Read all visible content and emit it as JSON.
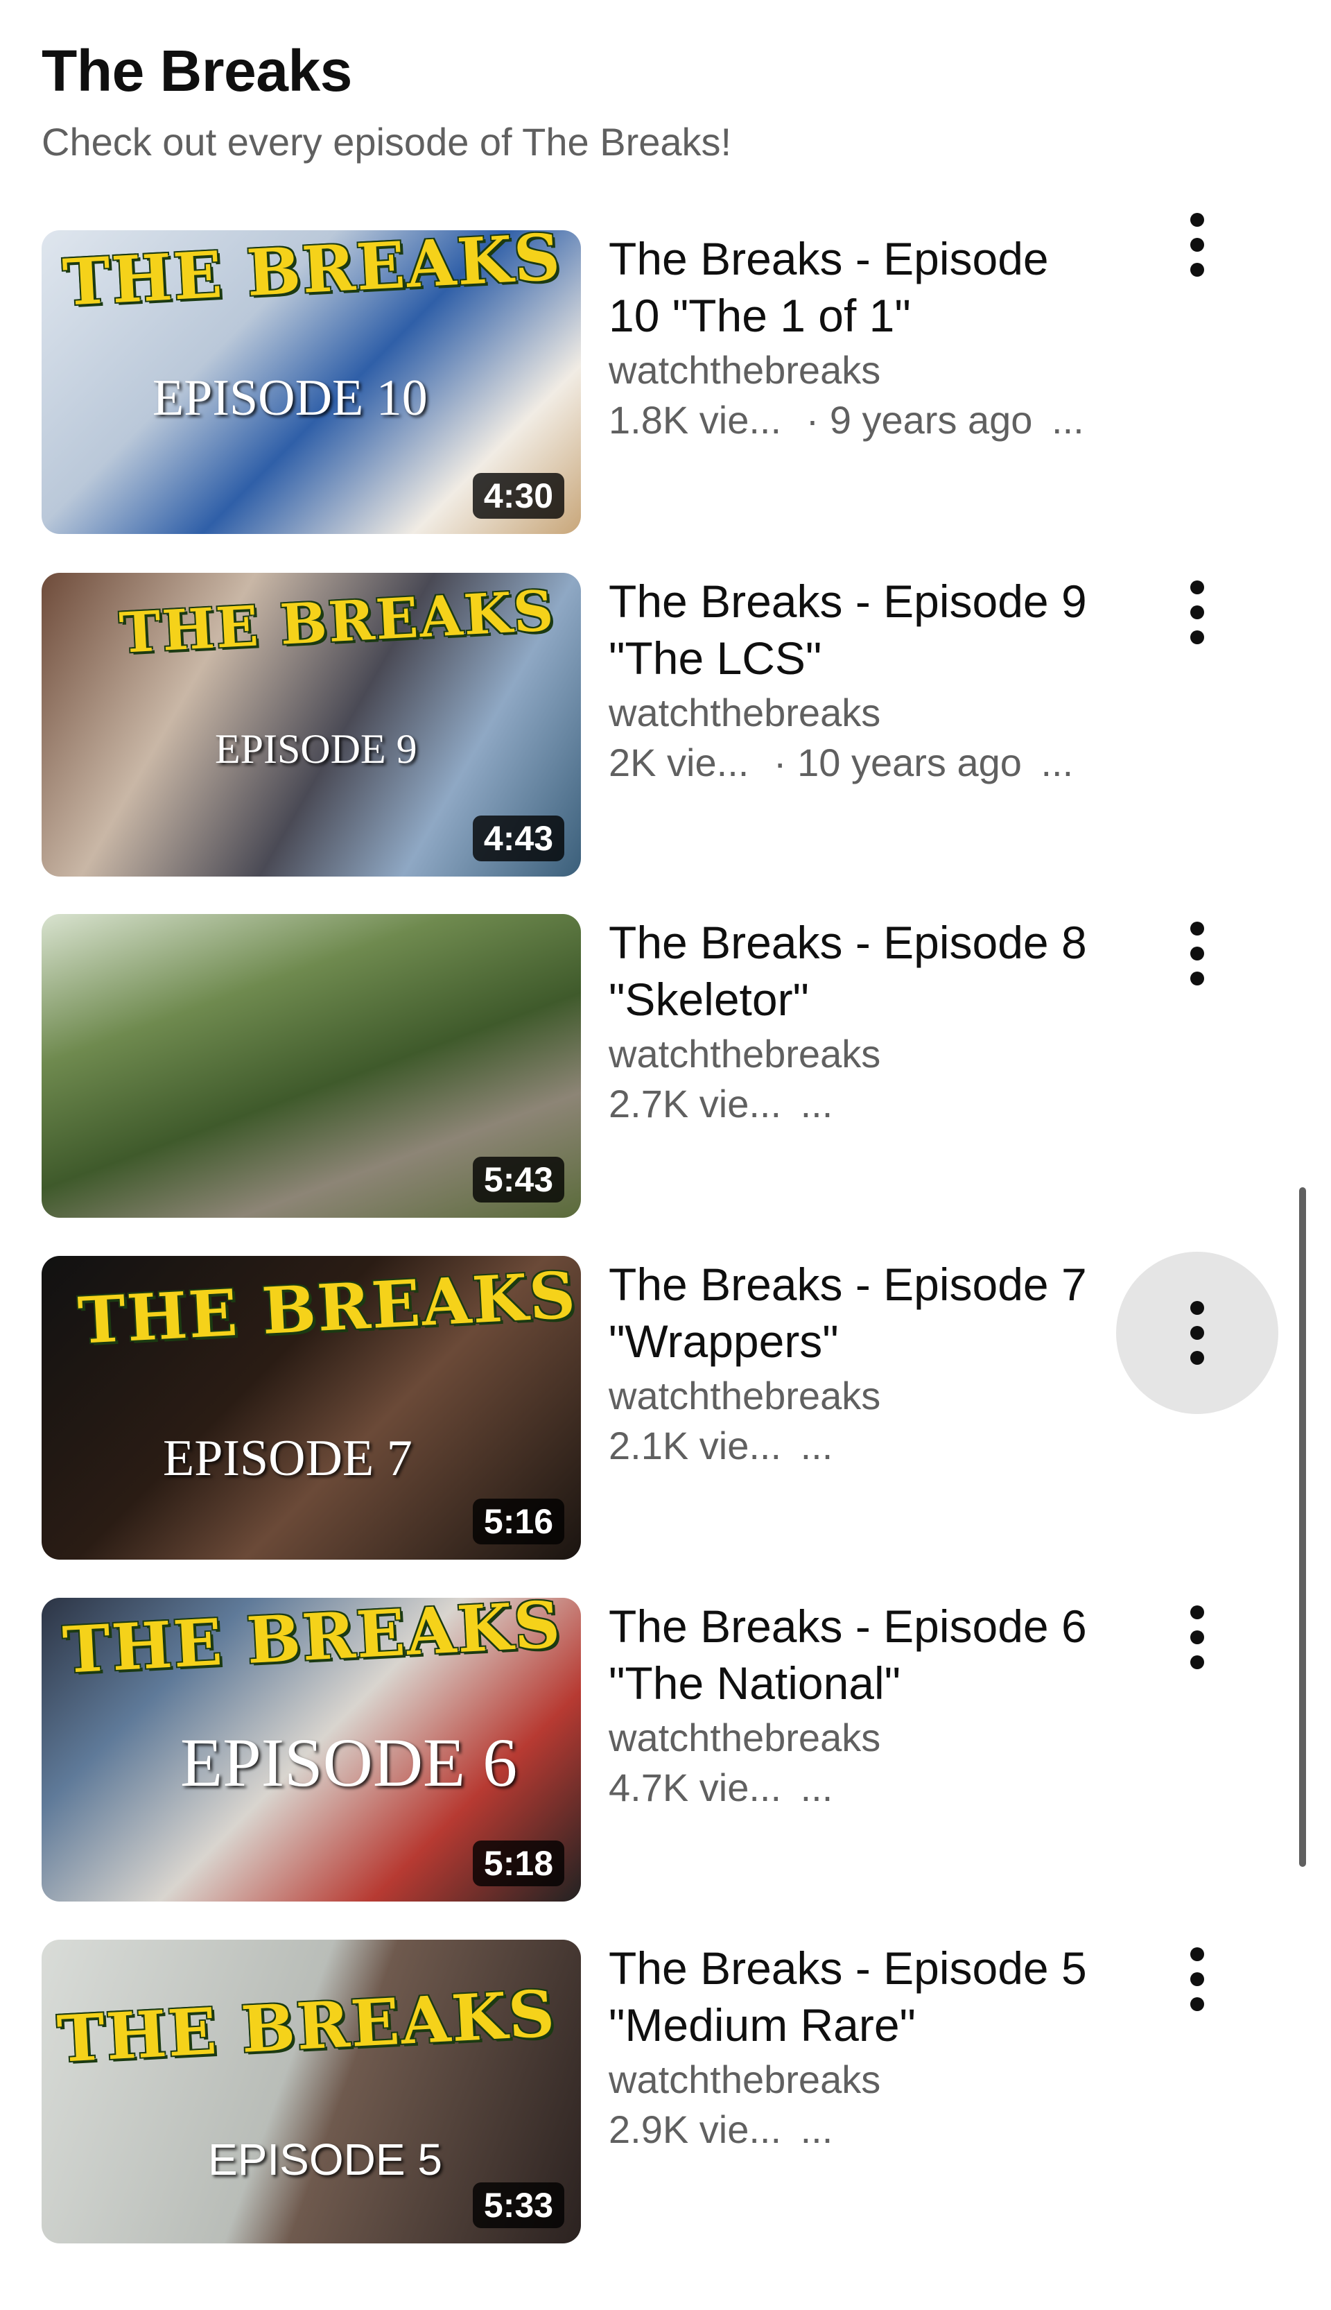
{
  "playlist": {
    "title": "The Breaks",
    "subtitle": "Check out every episode of The Breaks!"
  },
  "colors": {
    "accent_logo": "#f5d21a",
    "text_primary": "#0f0f0f",
    "text_secondary": "#606060",
    "menu_highlight": "#e5e5e5"
  },
  "videos": [
    {
      "title": "The Breaks - Episode 10 \"The 1 of 1\"",
      "channel": "watchthebreaks",
      "views": "1.8K vie...",
      "separator": "·",
      "age": "9 years ago",
      "more": "...",
      "duration": "4:30",
      "thumb_logo": "THE BREAKS",
      "thumb_episode": "EPISODE 10"
    },
    {
      "title": "The Breaks - Episode 9 \"The LCS\"",
      "channel": "watchthebreaks",
      "views": "2K vie...",
      "separator": "·",
      "age": "10 years ago",
      "more": "...",
      "duration": "4:43",
      "thumb_logo": "THE BREAKS",
      "thumb_episode": "EPISODE 9"
    },
    {
      "title": "The Breaks - Episode 8 \"Skeletor\"",
      "channel": "watchthebreaks",
      "views": "2.7K vie...",
      "more": "...",
      "duration": "5:43"
    },
    {
      "title": "The Breaks - Episode 7 \"Wrappers\"",
      "channel": "watchthebreaks",
      "views": "2.1K vie...",
      "more": "...",
      "duration": "5:16",
      "thumb_logo": "THE BREAKS",
      "thumb_episode": "EPISODE 7"
    },
    {
      "title": "The Breaks - Episode 6 \"The National\"",
      "channel": "watchthebreaks",
      "views": "4.7K vie...",
      "more": "...",
      "duration": "5:18",
      "thumb_logo": "THE BREAKS",
      "thumb_episode": "EPISODE 6"
    },
    {
      "title": "The Breaks - Episode 5 \"Medium Rare\"",
      "channel": "watchthebreaks",
      "views": "2.9K vie...",
      "more": "...",
      "duration": "5:33",
      "thumb_logo": "THE BREAKS",
      "thumb_episode": "EPISODE 5"
    }
  ],
  "icons": {
    "menu": "more-vert-icon"
  }
}
